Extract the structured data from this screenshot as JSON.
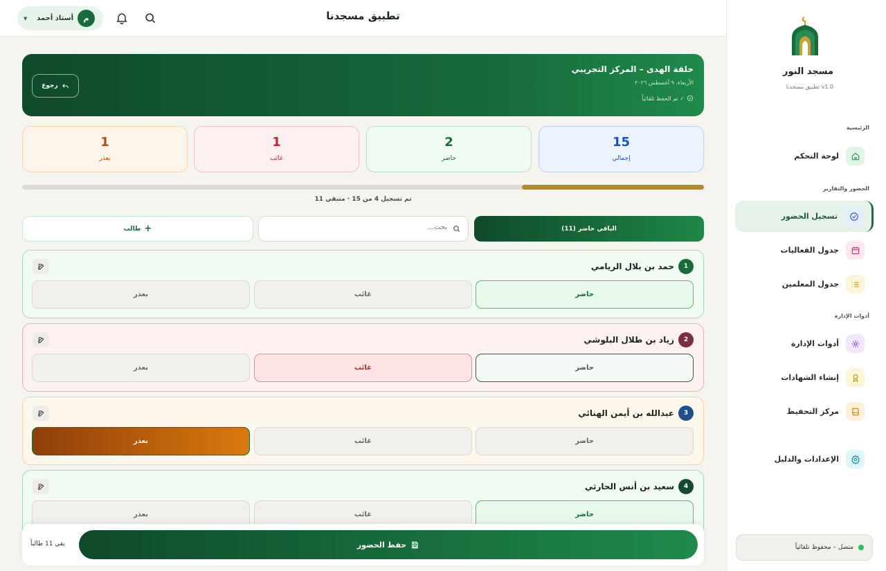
{
  "header": {
    "app_title": "تطبيق مسجدنا",
    "user_name": "أستاذ أحمد",
    "avatar_letter": "م"
  },
  "session": {
    "title": "حلقة الهدى – المركز التجريبي",
    "date": "الأربعاء، ٩ أغسطس ٢٠٢٦",
    "autosave": "تم الحفظ تلقائياً ✓",
    "back_label": "رجوع"
  },
  "stats": [
    {
      "value": "15",
      "label": "إجمالي",
      "color": "#1a4fc2",
      "bg": "#ebf3fe",
      "border": "#b8d4f5"
    },
    {
      "value": "2",
      "label": "حاضر",
      "color": "#1a6b3c",
      "bg": "#effaf1",
      "border": "#b5e5c3"
    },
    {
      "value": "1",
      "label": "غائب",
      "color": "#c0262d",
      "bg": "#fdf0f0",
      "border": "#f3c3c6"
    },
    {
      "value": "1",
      "label": "بعذر",
      "color": "#b44c0c",
      "bg": "#fef5ea",
      "border": "#f5d5b0"
    }
  ],
  "progress": {
    "fraction": 0.267,
    "color": "#b8892a",
    "text": "تم تسجيل 4 من 15 · متبقي 11"
  },
  "toolbar": {
    "remaining_button": "الباقي حاضر (11)",
    "search_placeholder": "بحث...",
    "add_student": "طالب"
  },
  "options": [
    "حاضر",
    "غائب",
    "بعذر"
  ],
  "students": [
    {
      "number": "1",
      "name": "حمد بن بلال الريامي",
      "status": "present",
      "badge_color": "#1a6b3c"
    },
    {
      "number": "2",
      "name": "زياد بن طلال البلوشي",
      "status": "absent",
      "badge_color": "#7a2e3e"
    },
    {
      "number": "3",
      "name": "عبدالله بن أيمن الهنائي",
      "status": "excused",
      "badge_color": "#1e4e8c"
    },
    {
      "number": "4",
      "name": "سعيد بن أنس الحارثي",
      "status": "present",
      "badge_color": "#154a2c"
    }
  ],
  "savebar": {
    "save_label": "حفظ الحضور",
    "remaining_note": "بقي 11 طالباً"
  },
  "sidebar": {
    "brand": "مسجد النور",
    "version": "تطبيق مسجدنا v1.0",
    "sections": {
      "home": "الرئيسية",
      "attendance": "الحضور والتقارير",
      "admin": "أدوات الإدارة"
    },
    "items": [
      {
        "label": "لوحة التحكم",
        "icon": "home-icon"
      },
      {
        "label": "تسجيل الحضور",
        "icon": "check-circle-icon"
      },
      {
        "label": "جدول الفعاليات",
        "icon": "calendar-icon"
      },
      {
        "label": "جدول المعلمين",
        "icon": "list-icon"
      },
      {
        "label": "أدوات الإدارة",
        "icon": "gear-icon"
      },
      {
        "label": "إنشاء الشهادات",
        "icon": "award-icon"
      },
      {
        "label": "مركز التحفيظ",
        "icon": "book-icon"
      },
      {
        "label": "الإعدادات والدليل",
        "icon": "settings-icon"
      }
    ],
    "status": "متصل – محفوظ تلقائياً"
  }
}
